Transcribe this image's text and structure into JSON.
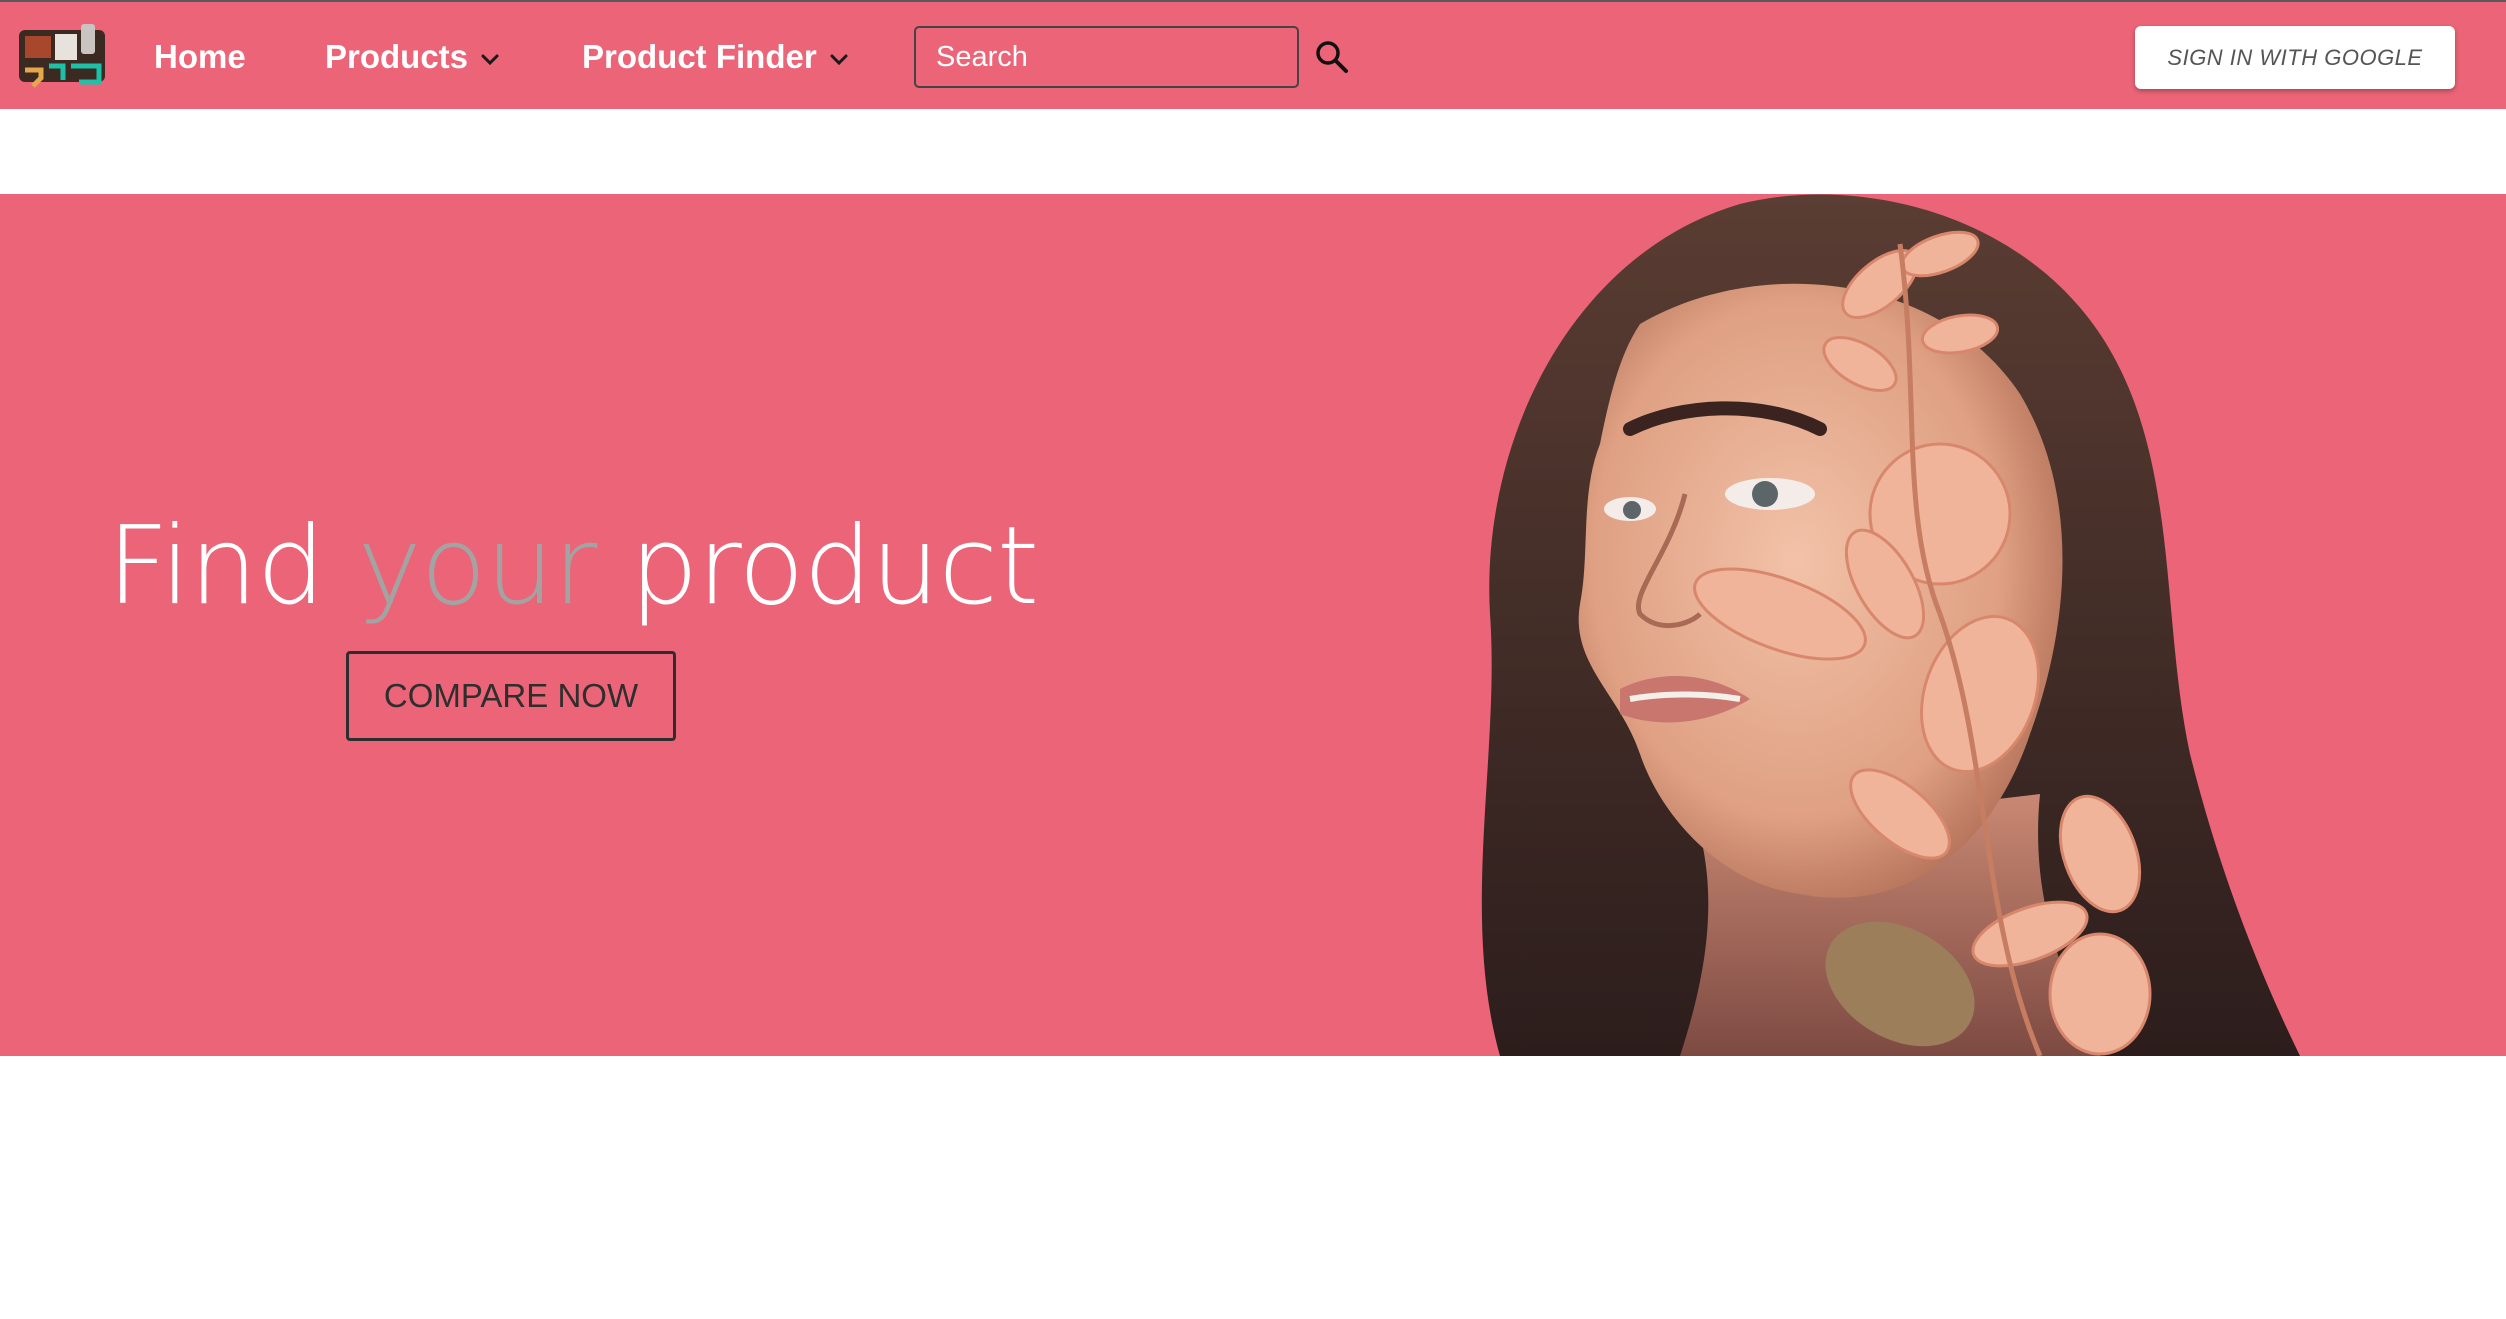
{
  "header": {
    "logo_alt": "site logo",
    "nav": {
      "home": "Home",
      "products": "Products",
      "product_finder": "Product Finder"
    },
    "search": {
      "placeholder": "Search"
    },
    "sign_in_label": "SIGN IN WITH GOOGLE"
  },
  "hero": {
    "title_part1": "Find ",
    "title_accent": "your",
    "title_part2": " product",
    "cta_label": "COMPARE NOW",
    "image_alt": "woman with leaves portrait"
  },
  "colors": {
    "brand": "#eb6477",
    "accent_text": "#a3a3a3",
    "cta_text": "#2e2e2e"
  },
  "icons": {
    "search": "search-icon",
    "dropdown": "chevron-down-icon"
  }
}
